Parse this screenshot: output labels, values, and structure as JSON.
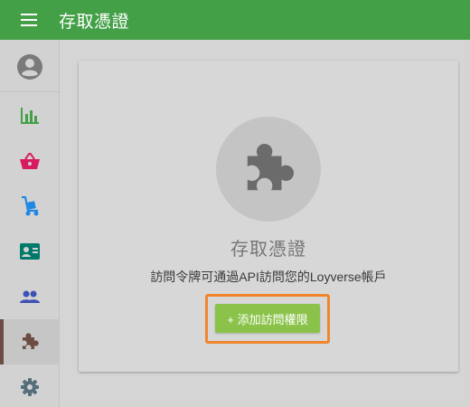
{
  "header": {
    "title": "存取憑證",
    "menu_icon": "hamburger-menu-icon"
  },
  "sidebar": {
    "items": [
      {
        "name": "account",
        "icon": "account-circle-icon",
        "color": "#7a7a7a"
      },
      {
        "name": "reports",
        "icon": "bar-chart-icon",
        "color": "#43a047"
      },
      {
        "name": "items",
        "icon": "shopping-basket-icon",
        "color": "#d81b60"
      },
      {
        "name": "inventory",
        "icon": "hand-truck-icon",
        "color": "#1e88e5"
      },
      {
        "name": "customers",
        "icon": "contact-card-icon",
        "color": "#00796b"
      },
      {
        "name": "employees",
        "icon": "people-icon",
        "color": "#3f51b5"
      },
      {
        "name": "integrations",
        "icon": "puzzle-icon",
        "color": "#6d4c41",
        "active": true
      },
      {
        "name": "settings",
        "icon": "gear-icon",
        "color": "#546e7a"
      }
    ]
  },
  "main": {
    "title": "存取憑證",
    "description": "訪問令牌可通過API訪問您的Loyverse帳戶",
    "add_button": "+ 添加訪問權限",
    "colors": {
      "accent": "#8bc34a",
      "highlight": "#f0862b",
      "header": "#43a047"
    }
  }
}
